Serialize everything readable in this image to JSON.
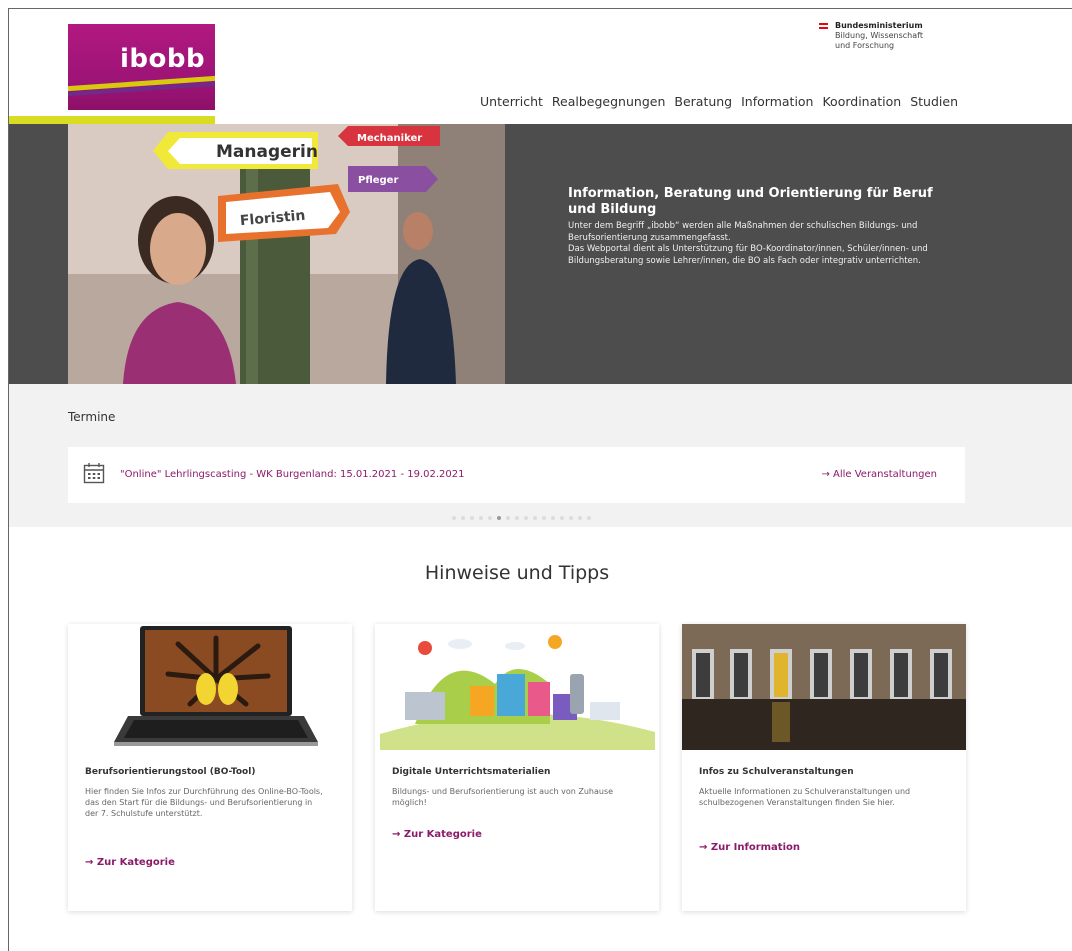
{
  "header": {
    "logo_text": "ibobb",
    "ministry": {
      "title": "Bundesministerium",
      "line1": "Bildung, Wissenschaft",
      "line2": "und Forschung"
    },
    "nav": [
      {
        "label": "Unterricht"
      },
      {
        "label": "Realbegegnungen"
      },
      {
        "label": "Beratung"
      },
      {
        "label": "Information"
      },
      {
        "label": "Koordination"
      },
      {
        "label": "Studien"
      }
    ]
  },
  "hero": {
    "signs": {
      "managerin": "Managerin",
      "mechaniker": "Mechaniker",
      "pfleger": "Pfleger",
      "floristin": "Floristin"
    },
    "title": "Information, Beratung und Orientierung für Beruf und Bildung",
    "body1": "Unter dem Begriff „ibobb“ werden alle Maßnahmen der schulischen Bildungs- und Berufsorientierung zusammengefasst.",
    "body2": "Das Webportal dient als Unterstützung für BO-Koordinator/innen, Schüler/innen- und Bildungsberatung sowie Lehrer/innen, die BO als Fach oder integrativ unterrichten."
  },
  "termine": {
    "heading": "Termine",
    "event": "\"Online\" Lehrlingscasting - WK Burgenland: 15.01.2021 - 19.02.2021",
    "all_link": "→ Alle Veranstaltungen",
    "active_dot": 5
  },
  "hinweise": {
    "title": "Hinweise und Tipps",
    "cards": [
      {
        "title": "Berufsorientierungstool (BO-Tool)",
        "text": "Hier finden Sie Infos zur Durchführung des Online-BO-Tools, das den Start für die Bildungs- und Berufsorientierung in der 7. Schulstufe unterstützt.",
        "link": "→ Zur Kategorie"
      },
      {
        "title": "Digitale Unterrichtsmaterialien",
        "text": "Bildungs- und Berufsorientierung ist auch von Zuhause möglich!",
        "link": "→ Zur Kategorie"
      },
      {
        "title": "Infos zu Schulveranstaltungen",
        "text": "Aktuelle Informationen zu Schulveranstaltungen und schulbezogenen Veranstaltungen finden Sie hier.",
        "link": "→ Zur Information"
      }
    ]
  },
  "colors": {
    "brand": "#9c1376",
    "accent": "#d8dd21",
    "link": "#8c1a6a",
    "hero_bg": "#4d4d4d"
  }
}
